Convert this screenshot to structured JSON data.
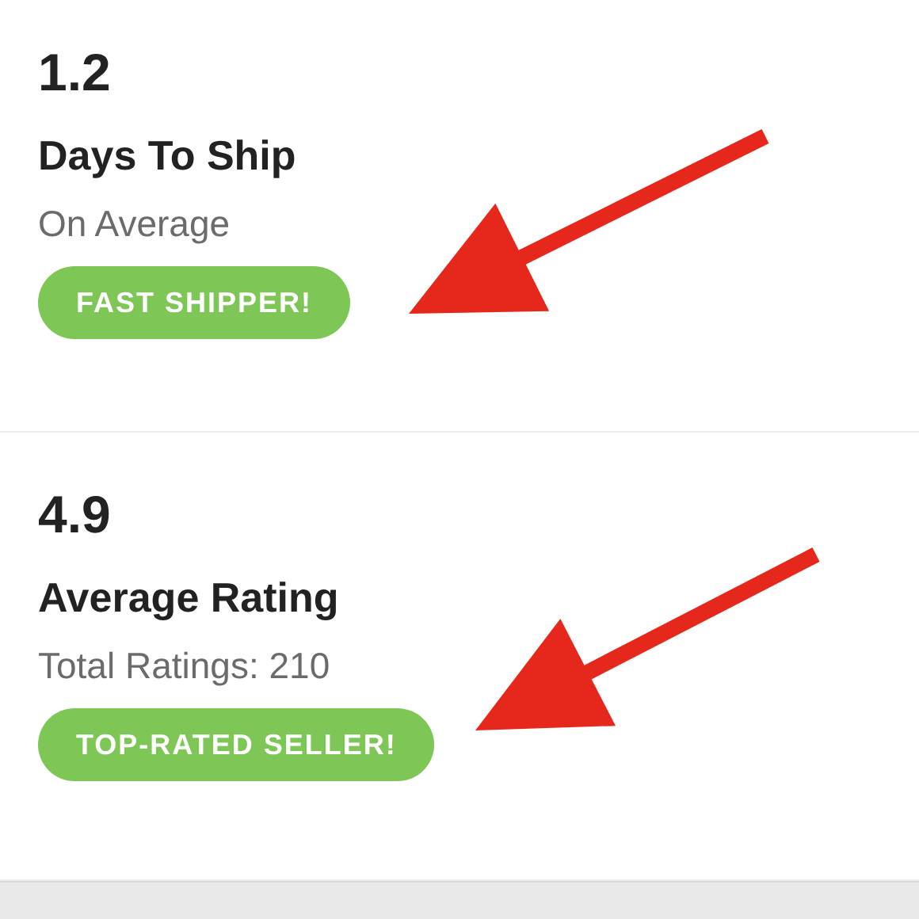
{
  "stats": [
    {
      "value": "1.2",
      "label": "Days To Ship",
      "sublabel": "On Average",
      "badge": "FAST SHIPPER!"
    },
    {
      "value": "4.9",
      "label": "Average Rating",
      "sublabel": "Total Ratings: 210",
      "badge": "TOP-RATED SELLER!"
    }
  ]
}
